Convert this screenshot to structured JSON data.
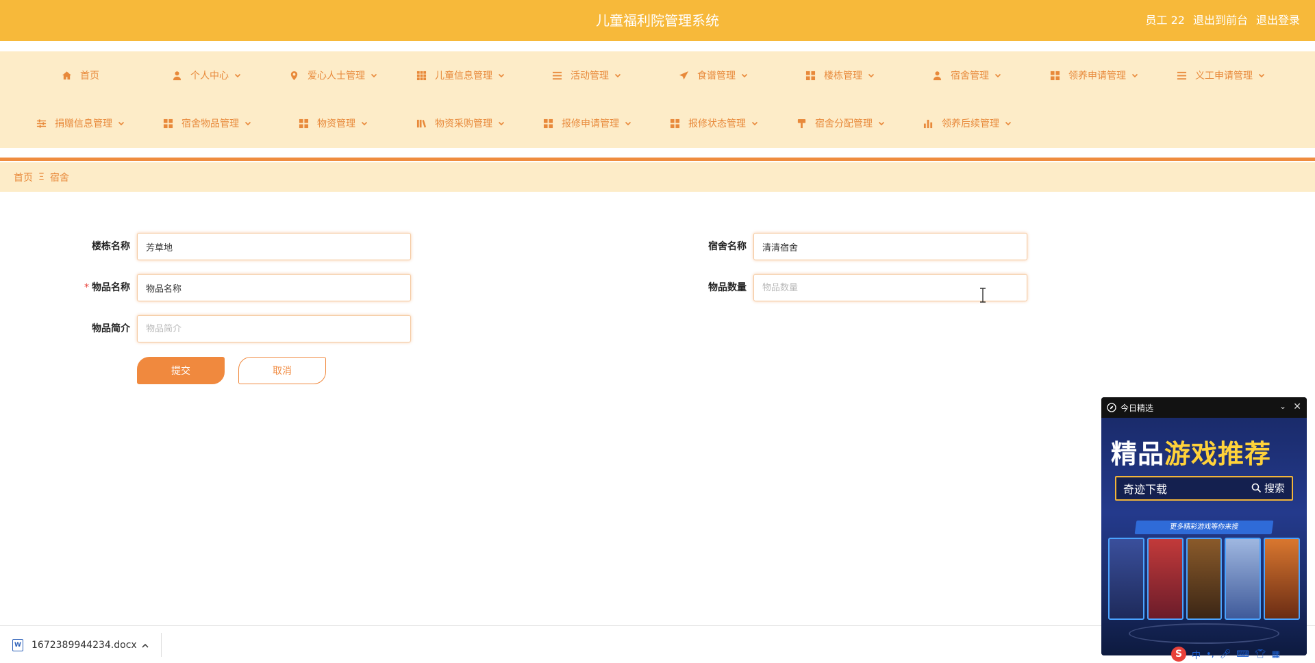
{
  "header": {
    "title": "儿童福利院管理系统",
    "user": "员工 22",
    "back_to_front": "退出到前台",
    "logout": "退出登录"
  },
  "nav": {
    "row1": [
      {
        "label": "首页",
        "icon": "home-icon",
        "dropdown": false
      },
      {
        "label": "个人中心",
        "icon": "user-icon",
        "dropdown": true
      },
      {
        "label": "爱心人士管理",
        "icon": "location-pin-icon",
        "dropdown": true
      },
      {
        "label": "儿童信息管理",
        "icon": "grid-icon",
        "dropdown": true
      },
      {
        "label": "活动管理",
        "icon": "list-icon",
        "dropdown": true
      },
      {
        "label": "食谱管理",
        "icon": "paper-plane-icon",
        "dropdown": true
      },
      {
        "label": "楼栋管理",
        "icon": "apps-icon",
        "dropdown": true
      },
      {
        "label": "宿舍管理",
        "icon": "user-icon",
        "dropdown": true
      },
      {
        "label": "领养申请管理",
        "icon": "apps-icon",
        "dropdown": true
      },
      {
        "label": "义工申请管理",
        "icon": "list-icon",
        "dropdown": true
      }
    ],
    "row2": [
      {
        "label": "捐赠信息管理",
        "icon": "sliders-icon",
        "dropdown": true
      },
      {
        "label": "宿舍物品管理",
        "icon": "apps-icon",
        "dropdown": true
      },
      {
        "label": "物资管理",
        "icon": "apps-icon",
        "dropdown": true
      },
      {
        "label": "物资采购管理",
        "icon": "books-icon",
        "dropdown": true
      },
      {
        "label": "报修申请管理",
        "icon": "apps-icon",
        "dropdown": true
      },
      {
        "label": "报修状态管理",
        "icon": "apps-icon",
        "dropdown": true
      },
      {
        "label": "宿舍分配管理",
        "icon": "brush-icon",
        "dropdown": true
      },
      {
        "label": "领养后续管理",
        "icon": "bar-chart-icon",
        "dropdown": true
      }
    ]
  },
  "breadcrumb": {
    "home": "首页",
    "separator": "Ξ",
    "current": "宿舍"
  },
  "form": {
    "building_label": "楼栋名称",
    "building_value": "芳草地",
    "dorm_label": "宿舍名称",
    "dorm_value": "清清宿舍",
    "item_name_label": "物品名称",
    "item_name_value": "物品名称",
    "required_mark": "*",
    "item_qty_label": "物品数量",
    "item_qty_placeholder": "物品数量",
    "item_desc_label": "物品简介",
    "item_desc_placeholder": "物品简介",
    "submit_label": "提交",
    "cancel_label": "取消"
  },
  "download_bar": {
    "file_name": "1672389944234.docx",
    "file_icon_letter": "W"
  },
  "ad": {
    "header_title": "今日精选",
    "title_white": "精品",
    "title_yellow": "游戏推荐",
    "search_text": "奇迹下载",
    "search_button": "搜索",
    "banner_text": "更多精彩游戏等你来搜"
  },
  "ime": {
    "logo": "S",
    "mode": "中"
  },
  "colors": {
    "header_bg": "#f7b93a",
    "nav_bg": "#fdecc8",
    "accent": "#ef8c3f"
  }
}
